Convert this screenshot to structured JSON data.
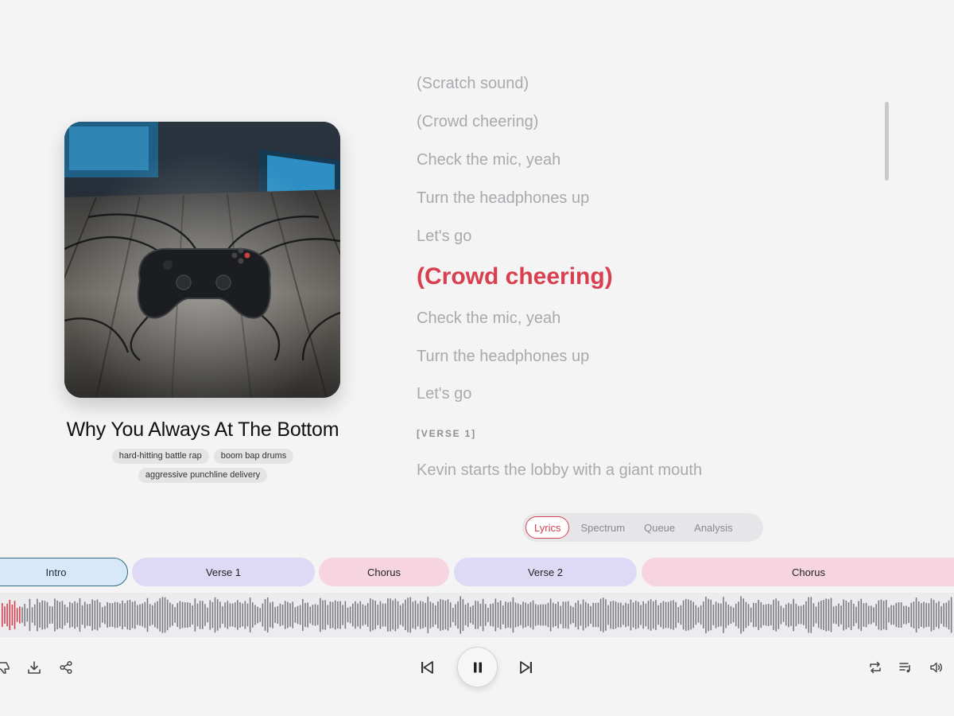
{
  "track": {
    "title": "Why You Always At The Bottom",
    "tags": [
      "hard-hitting battle rap",
      "boom bap drums",
      "aggressive punchline delivery"
    ]
  },
  "lyrics": {
    "lines": [
      {
        "text": "(Scratch sound)",
        "kind": "line"
      },
      {
        "text": "(Crowd cheering)",
        "kind": "line"
      },
      {
        "text": "Check the mic, yeah",
        "kind": "line"
      },
      {
        "text": "Turn the headphones up",
        "kind": "line"
      },
      {
        "text": "Let's go",
        "kind": "line"
      },
      {
        "text": "(Crowd cheering)",
        "kind": "active"
      },
      {
        "text": "Check the mic, yeah",
        "kind": "line"
      },
      {
        "text": "Turn the headphones up",
        "kind": "line"
      },
      {
        "text": "Let's go",
        "kind": "line"
      },
      {
        "text": "[VERSE 1]",
        "kind": "section"
      },
      {
        "text": "Kevin starts the lobby with a giant mouth",
        "kind": "line"
      }
    ]
  },
  "view_tabs": [
    {
      "label": "Lyrics",
      "selected": true
    },
    {
      "label": "Spectrum",
      "selected": false
    },
    {
      "label": "Queue",
      "selected": false
    },
    {
      "label": "Analysis",
      "selected": false
    }
  ],
  "sections": [
    {
      "label": "Intro",
      "type": "intro"
    },
    {
      "label": "Verse 1",
      "type": "verse"
    },
    {
      "label": "Chorus",
      "type": "chorus"
    },
    {
      "label": "Verse 2",
      "type": "verse"
    },
    {
      "label": "Chorus",
      "type": "chorus"
    }
  ],
  "playback": {
    "state": "playing",
    "progress": 0.02
  },
  "controls": {
    "left": [
      "thumbs-down-icon",
      "download-icon",
      "share-icon"
    ],
    "center": [
      "previous-track-icon",
      "pause-icon",
      "next-track-icon"
    ],
    "right": [
      "repeat-icon",
      "playlist-icon",
      "volume-icon"
    ]
  },
  "colors": {
    "accent": "#d8404f",
    "intro": "#d7e8f8",
    "verse": "#dedaf5",
    "chorus": "#f6d4e0",
    "waveform_played": "#d8404f",
    "waveform_unplayed": "#7c7c80"
  }
}
